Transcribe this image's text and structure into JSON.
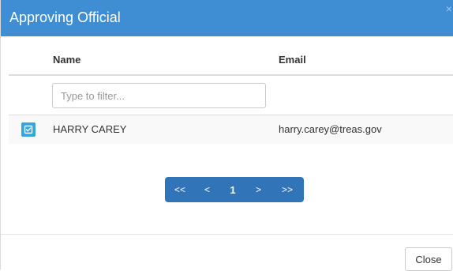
{
  "modal": {
    "title": "Approving Official",
    "close_glyph": "×"
  },
  "table": {
    "columns": {
      "name": "Name",
      "email": "Email"
    },
    "filter": {
      "placeholder": "Type to filter...",
      "value": ""
    },
    "rows": [
      {
        "name": "HARRY CAREY",
        "email": "harry.carey@treas.gov",
        "selected": true
      }
    ]
  },
  "pagination": {
    "first": "<<",
    "prev": "<",
    "current": "1",
    "next": ">",
    "last": ">>"
  },
  "footer": {
    "close_label": "Close"
  },
  "colors": {
    "header": "#3f8ed3",
    "pager": "#3274b8",
    "check": "#31a6e0"
  }
}
